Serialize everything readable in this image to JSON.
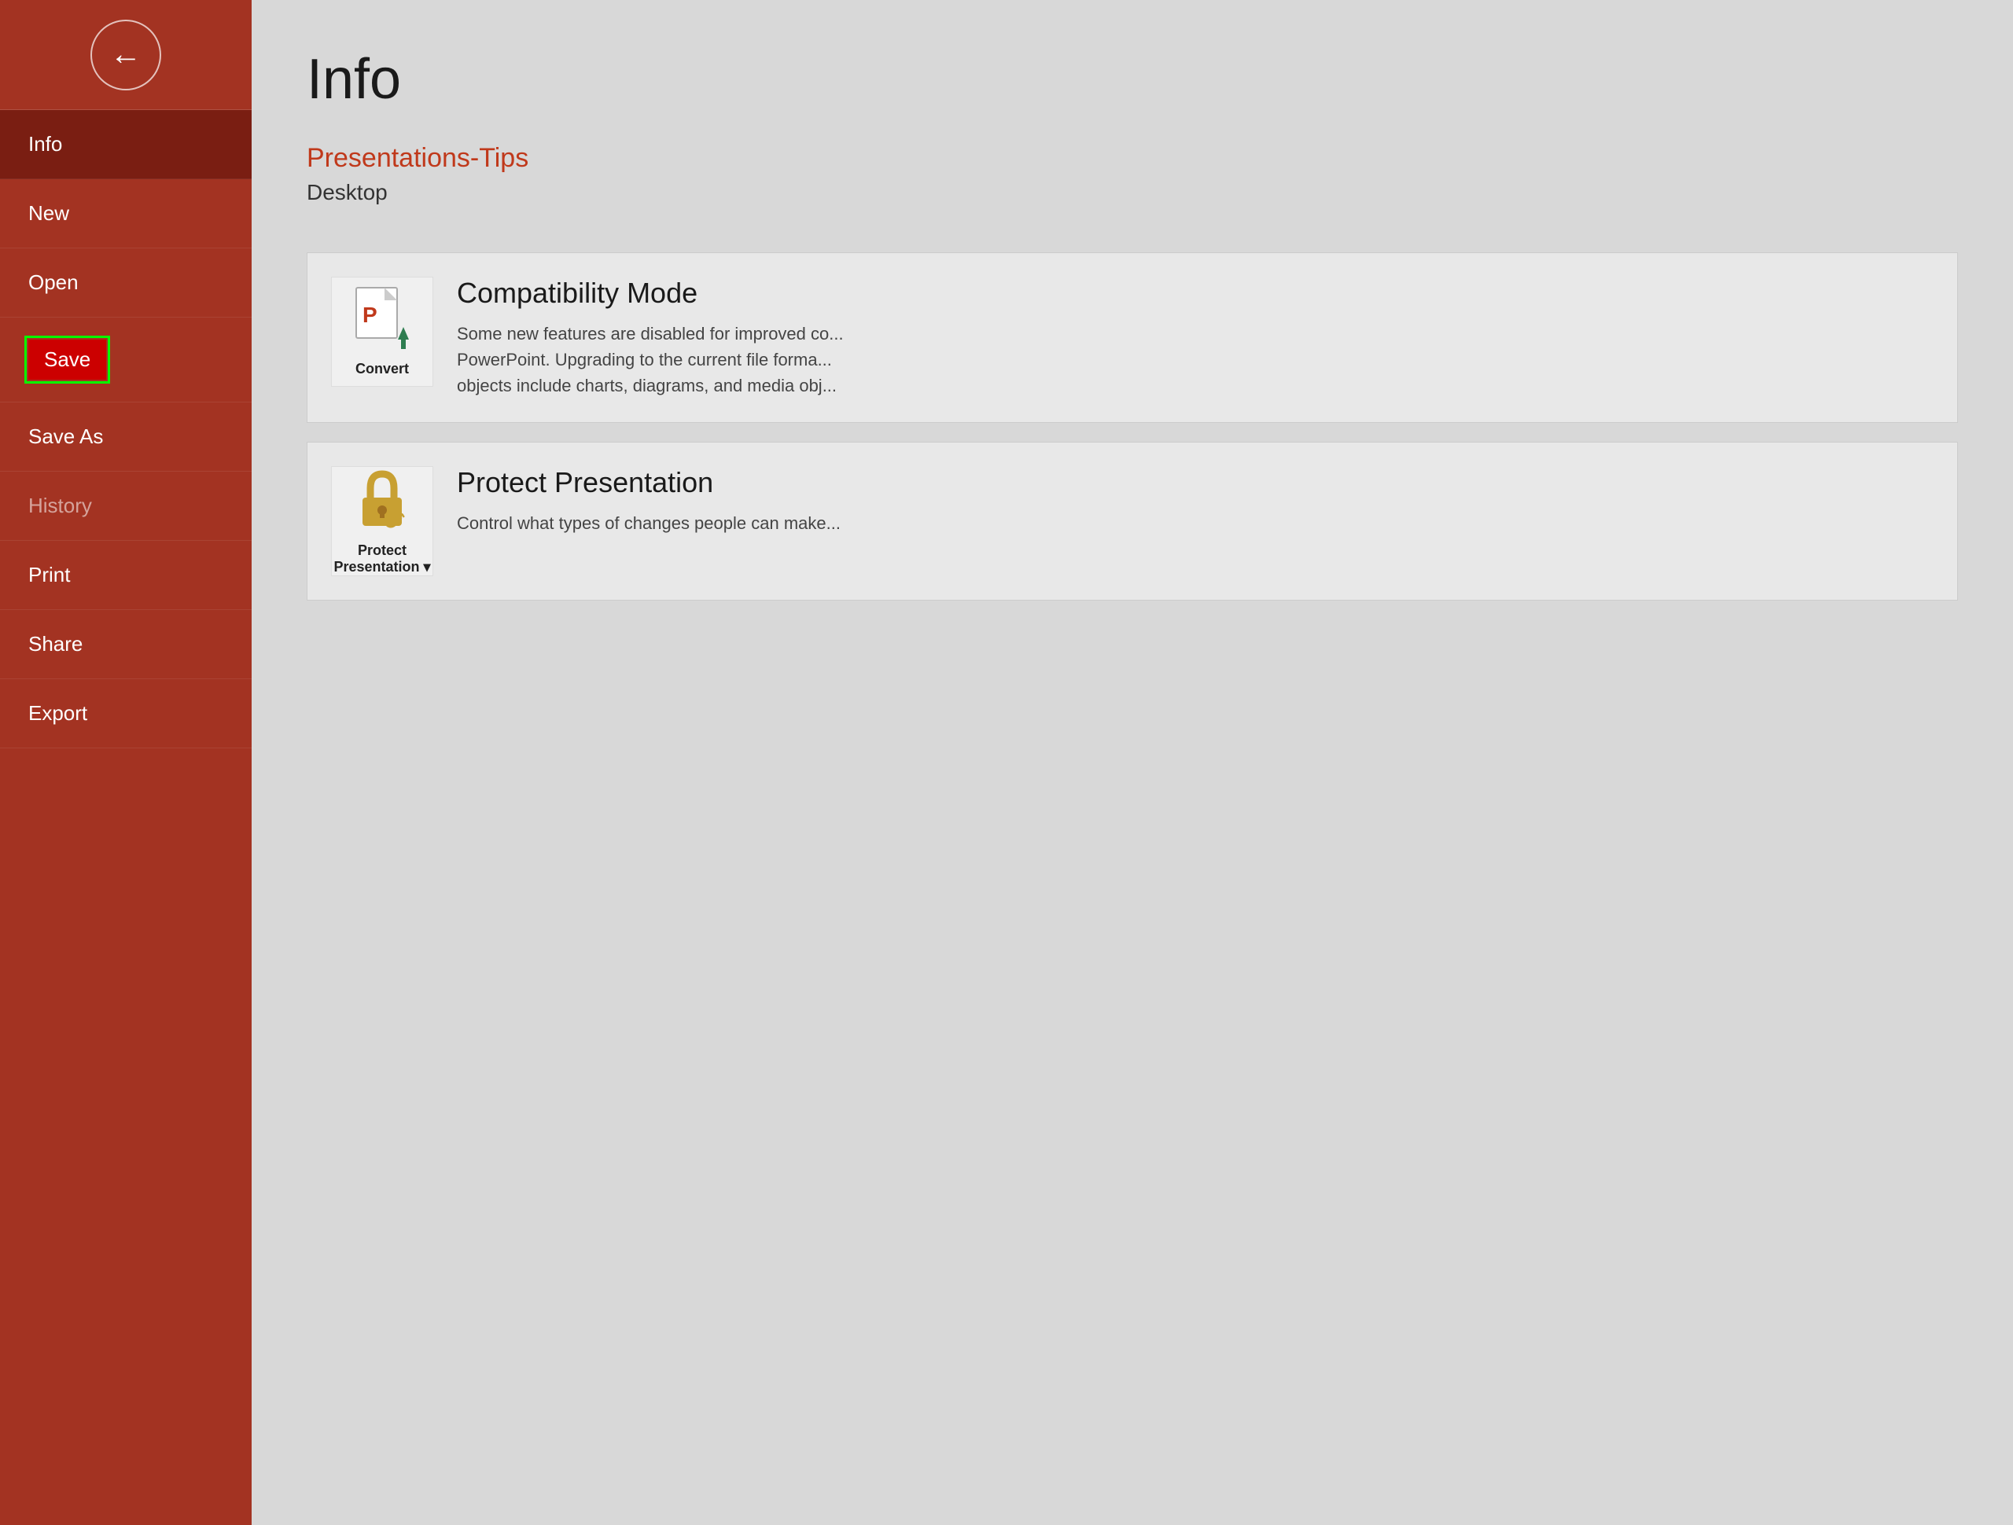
{
  "sidebar": {
    "back_button_label": "←",
    "items": [
      {
        "id": "info",
        "label": "Info",
        "state": "active"
      },
      {
        "id": "new",
        "label": "New",
        "state": "normal"
      },
      {
        "id": "open",
        "label": "Open",
        "state": "normal"
      },
      {
        "id": "save",
        "label": "Save",
        "state": "highlighted"
      },
      {
        "id": "save-as",
        "label": "Save As",
        "state": "normal"
      },
      {
        "id": "history",
        "label": "History",
        "state": "dimmed"
      },
      {
        "id": "print",
        "label": "Print",
        "state": "normal"
      },
      {
        "id": "share",
        "label": "Share",
        "state": "normal"
      },
      {
        "id": "export",
        "label": "Export",
        "state": "normal"
      }
    ]
  },
  "main": {
    "page_title": "Info",
    "file_name": "Presentations-Tips",
    "file_location": "Desktop",
    "cards": [
      {
        "id": "convert",
        "icon_label": "Convert",
        "title": "Compatibility Mode",
        "description": "Some new features are disabled for improved co... PowerPoint. Upgrading to the current file forma... objects include charts, diagrams, and media obj..."
      },
      {
        "id": "protect",
        "icon_label": "Protect\nPresentation ▾",
        "title": "Protect Presentation",
        "description": "Control what types of changes people can make..."
      }
    ]
  },
  "colors": {
    "sidebar_bg": "#a33322",
    "sidebar_active": "#7a1e12",
    "accent_orange": "#c0391b",
    "main_bg": "#d8d8d8"
  }
}
